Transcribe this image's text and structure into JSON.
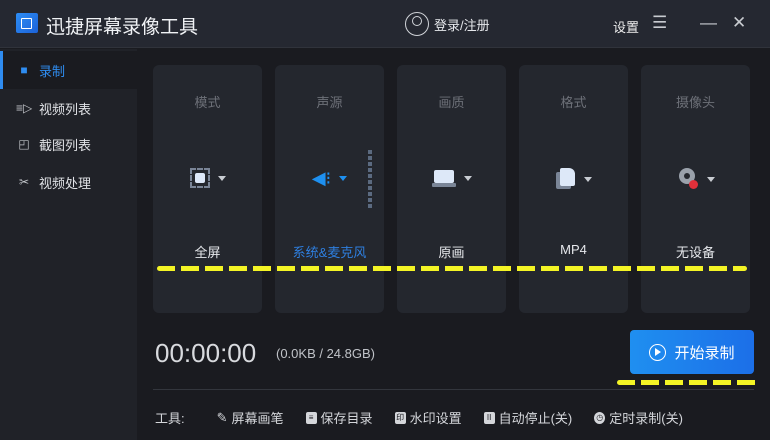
{
  "app": {
    "title": "迅捷屏幕录像工具",
    "login": "登录/注册",
    "settings": "设置"
  },
  "sidebar": {
    "items": [
      {
        "label": "录制",
        "icon": "camera-icon",
        "active": true
      },
      {
        "label": "视频列表",
        "icon": "video-list-icon"
      },
      {
        "label": "截图列表",
        "icon": "screenshot-list-icon"
      },
      {
        "label": "视频处理",
        "icon": "video-tools-icon"
      }
    ]
  },
  "cards": [
    {
      "label": "模式",
      "value": "全屏",
      "icon": "fullscreen-icon"
    },
    {
      "label": "声源",
      "value": "系统&麦克风",
      "icon": "speaker-icon"
    },
    {
      "label": "画质",
      "value": "原画",
      "icon": "laptop-icon"
    },
    {
      "label": "格式",
      "value": "MP4",
      "icon": "file-icon"
    },
    {
      "label": "摄像头",
      "value": "无设备",
      "icon": "webcam-icon"
    }
  ],
  "status": {
    "timer": "00:00:00",
    "size": "(0.0KB / 24.8GB)"
  },
  "record_button": "开始录制",
  "tools": {
    "label": "工具:",
    "items": [
      "屏幕画笔",
      "保存目录",
      "水印设置",
      "自动停止(关)",
      "定时录制(关)"
    ]
  },
  "colors": {
    "accent": "#2f8cf0",
    "annotation": "#f4f425"
  }
}
